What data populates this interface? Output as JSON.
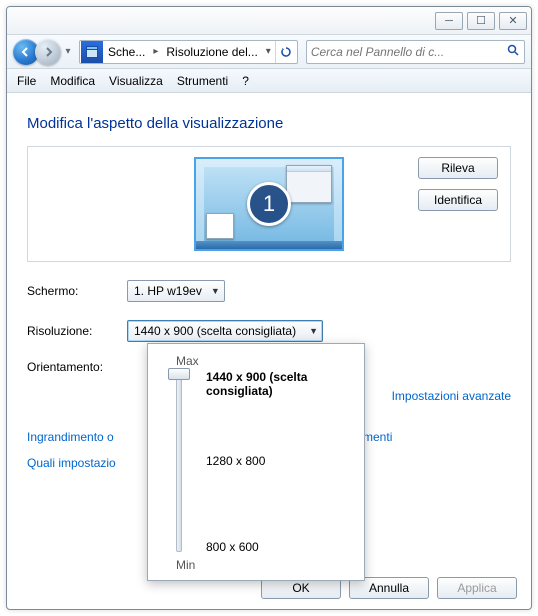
{
  "window": {
    "min_glyph": "─",
    "max_glyph": "☐",
    "close_glyph": "✕"
  },
  "nav": {
    "bc_item1": "Sche...",
    "bc_item2": "Risoluzione del...",
    "search_placeholder": "Cerca nel Pannello di c..."
  },
  "menu": {
    "file": "File",
    "modifica": "Modifica",
    "visualizza": "Visualizza",
    "strumenti": "Strumenti",
    "help": "?"
  },
  "heading": "Modifica l'aspetto della visualizzazione",
  "buttons": {
    "rileva": "Rileva",
    "identifica": "Identifica",
    "ok": "OK",
    "annulla": "Annulla",
    "applica": "Applica"
  },
  "monitor_number": "1",
  "labels": {
    "schermo": "Schermo:",
    "risoluzione": "Risoluzione:",
    "orientamento": "Orientamento:"
  },
  "values": {
    "schermo": "1. HP w19ev",
    "risoluzione": "1440 x 900 (scelta consigliata)"
  },
  "links": {
    "avanzate": "Impostazioni avanzate",
    "ingrandimento": "Ingrandimento o",
    "ingrandimento_tail": "elementi",
    "quali": "Quali impostazio"
  },
  "popup": {
    "max": "Max",
    "min": "Min",
    "opt1": "1440 x 900 (scelta consigliata)",
    "opt2": "1280 x 800",
    "opt3": "800 x 600"
  }
}
